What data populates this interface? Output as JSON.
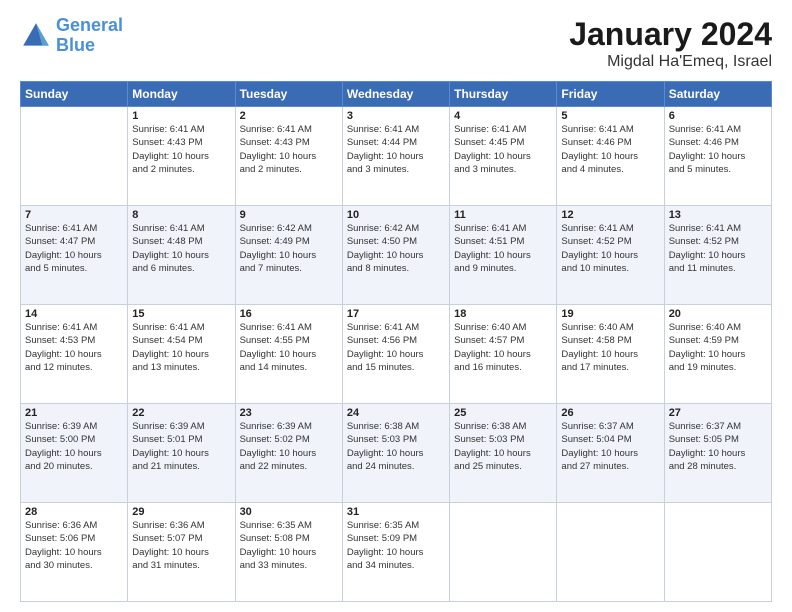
{
  "header": {
    "logo_line1": "General",
    "logo_line2": "Blue",
    "month": "January 2024",
    "location": "Migdal Ha'Emeq, Israel"
  },
  "weekdays": [
    "Sunday",
    "Monday",
    "Tuesday",
    "Wednesday",
    "Thursday",
    "Friday",
    "Saturday"
  ],
  "rows": [
    [
      {
        "day": "",
        "info": ""
      },
      {
        "day": "1",
        "info": "Sunrise: 6:41 AM\nSunset: 4:43 PM\nDaylight: 10 hours\nand 2 minutes."
      },
      {
        "day": "2",
        "info": "Sunrise: 6:41 AM\nSunset: 4:43 PM\nDaylight: 10 hours\nand 2 minutes."
      },
      {
        "day": "3",
        "info": "Sunrise: 6:41 AM\nSunset: 4:44 PM\nDaylight: 10 hours\nand 3 minutes."
      },
      {
        "day": "4",
        "info": "Sunrise: 6:41 AM\nSunset: 4:45 PM\nDaylight: 10 hours\nand 3 minutes."
      },
      {
        "day": "5",
        "info": "Sunrise: 6:41 AM\nSunset: 4:46 PM\nDaylight: 10 hours\nand 4 minutes."
      },
      {
        "day": "6",
        "info": "Sunrise: 6:41 AM\nSunset: 4:46 PM\nDaylight: 10 hours\nand 5 minutes."
      }
    ],
    [
      {
        "day": "7",
        "info": "Sunrise: 6:41 AM\nSunset: 4:47 PM\nDaylight: 10 hours\nand 5 minutes."
      },
      {
        "day": "8",
        "info": "Sunrise: 6:41 AM\nSunset: 4:48 PM\nDaylight: 10 hours\nand 6 minutes."
      },
      {
        "day": "9",
        "info": "Sunrise: 6:42 AM\nSunset: 4:49 PM\nDaylight: 10 hours\nand 7 minutes."
      },
      {
        "day": "10",
        "info": "Sunrise: 6:42 AM\nSunset: 4:50 PM\nDaylight: 10 hours\nand 8 minutes."
      },
      {
        "day": "11",
        "info": "Sunrise: 6:41 AM\nSunset: 4:51 PM\nDaylight: 10 hours\nand 9 minutes."
      },
      {
        "day": "12",
        "info": "Sunrise: 6:41 AM\nSunset: 4:52 PM\nDaylight: 10 hours\nand 10 minutes."
      },
      {
        "day": "13",
        "info": "Sunrise: 6:41 AM\nSunset: 4:52 PM\nDaylight: 10 hours\nand 11 minutes."
      }
    ],
    [
      {
        "day": "14",
        "info": "Sunrise: 6:41 AM\nSunset: 4:53 PM\nDaylight: 10 hours\nand 12 minutes."
      },
      {
        "day": "15",
        "info": "Sunrise: 6:41 AM\nSunset: 4:54 PM\nDaylight: 10 hours\nand 13 minutes."
      },
      {
        "day": "16",
        "info": "Sunrise: 6:41 AM\nSunset: 4:55 PM\nDaylight: 10 hours\nand 14 minutes."
      },
      {
        "day": "17",
        "info": "Sunrise: 6:41 AM\nSunset: 4:56 PM\nDaylight: 10 hours\nand 15 minutes."
      },
      {
        "day": "18",
        "info": "Sunrise: 6:40 AM\nSunset: 4:57 PM\nDaylight: 10 hours\nand 16 minutes."
      },
      {
        "day": "19",
        "info": "Sunrise: 6:40 AM\nSunset: 4:58 PM\nDaylight: 10 hours\nand 17 minutes."
      },
      {
        "day": "20",
        "info": "Sunrise: 6:40 AM\nSunset: 4:59 PM\nDaylight: 10 hours\nand 19 minutes."
      }
    ],
    [
      {
        "day": "21",
        "info": "Sunrise: 6:39 AM\nSunset: 5:00 PM\nDaylight: 10 hours\nand 20 minutes."
      },
      {
        "day": "22",
        "info": "Sunrise: 6:39 AM\nSunset: 5:01 PM\nDaylight: 10 hours\nand 21 minutes."
      },
      {
        "day": "23",
        "info": "Sunrise: 6:39 AM\nSunset: 5:02 PM\nDaylight: 10 hours\nand 22 minutes."
      },
      {
        "day": "24",
        "info": "Sunrise: 6:38 AM\nSunset: 5:03 PM\nDaylight: 10 hours\nand 24 minutes."
      },
      {
        "day": "25",
        "info": "Sunrise: 6:38 AM\nSunset: 5:03 PM\nDaylight: 10 hours\nand 25 minutes."
      },
      {
        "day": "26",
        "info": "Sunrise: 6:37 AM\nSunset: 5:04 PM\nDaylight: 10 hours\nand 27 minutes."
      },
      {
        "day": "27",
        "info": "Sunrise: 6:37 AM\nSunset: 5:05 PM\nDaylight: 10 hours\nand 28 minutes."
      }
    ],
    [
      {
        "day": "28",
        "info": "Sunrise: 6:36 AM\nSunset: 5:06 PM\nDaylight: 10 hours\nand 30 minutes."
      },
      {
        "day": "29",
        "info": "Sunrise: 6:36 AM\nSunset: 5:07 PM\nDaylight: 10 hours\nand 31 minutes."
      },
      {
        "day": "30",
        "info": "Sunrise: 6:35 AM\nSunset: 5:08 PM\nDaylight: 10 hours\nand 33 minutes."
      },
      {
        "day": "31",
        "info": "Sunrise: 6:35 AM\nSunset: 5:09 PM\nDaylight: 10 hours\nand 34 minutes."
      },
      {
        "day": "",
        "info": ""
      },
      {
        "day": "",
        "info": ""
      },
      {
        "day": "",
        "info": ""
      }
    ]
  ]
}
